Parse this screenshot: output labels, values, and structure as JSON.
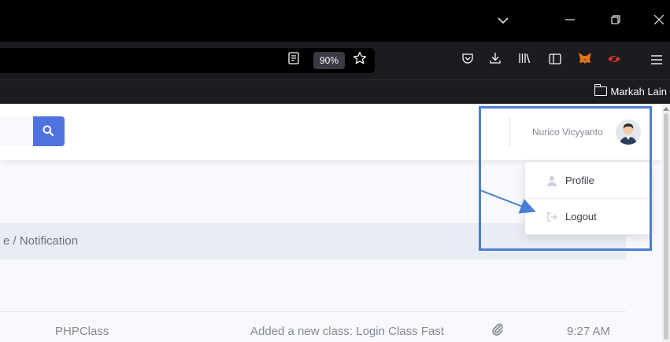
{
  "browser": {
    "zoom": "90%",
    "bookmarks_folder": "Markah Lain",
    "window_controls": [
      "chevron-down-icon",
      "minimize-icon",
      "restore-icon",
      "close-icon"
    ],
    "toolbar_icons": [
      "pocket-icon",
      "download-icon",
      "library-icon",
      "sidebar-icon",
      "metamask-fox-icon",
      "extension-eye-off-icon",
      "hamburger-menu-icon"
    ]
  },
  "topbar": {
    "user_name": "Nurico Vicyyanto"
  },
  "user_menu": {
    "items": [
      {
        "label": "Profile",
        "icon": "user-icon"
      },
      {
        "label": "Logout",
        "icon": "sign-out-icon"
      }
    ]
  },
  "breadcrumb": {
    "text": "e / Notification"
  },
  "notification_row": {
    "sender": "PHPClass",
    "message": "Added a new class: Login Class Fast",
    "attachment_icon": "paperclip-icon",
    "time": "9:27 AM"
  },
  "colors": {
    "primary": "#4e73df",
    "annotation": "#4a7fd4",
    "metamask_orange": "#e2761b",
    "extension_red": "#d9342b"
  }
}
